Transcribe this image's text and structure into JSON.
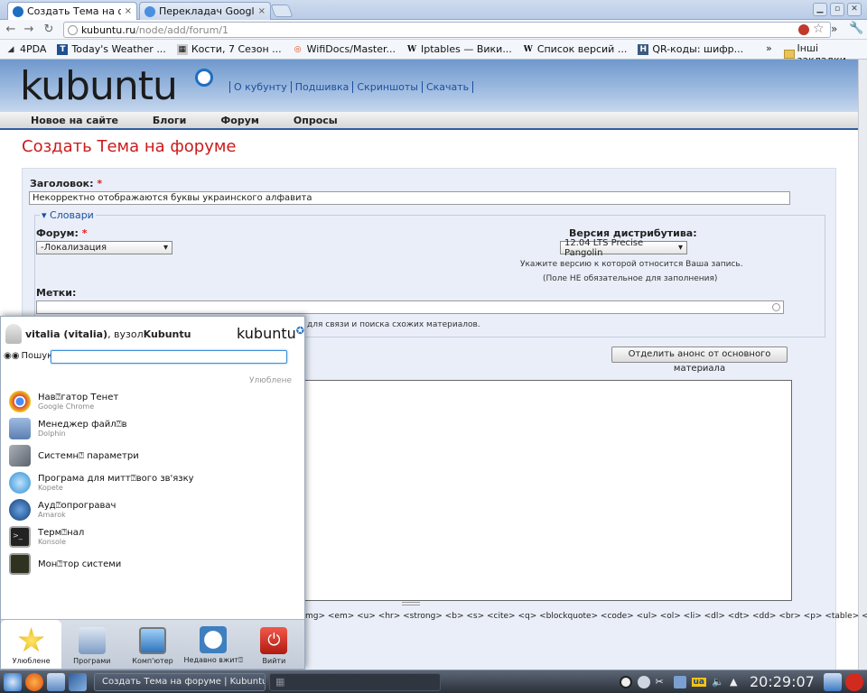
{
  "browser": {
    "tabs": [
      {
        "label": "Создать Тема на фору",
        "icon": "kubuntu-icon",
        "active": true
      },
      {
        "label": "Перекладач Google",
        "icon": "google-translate-icon",
        "active": false
      }
    ],
    "close_glyph": "×",
    "url_host": "kubuntu.ru",
    "url_path": "/node/add/forum/1",
    "bookmarks": [
      {
        "label": "4PDA",
        "icon": "4pda-icon"
      },
      {
        "label": "Today's Weather ...",
        "icon": "twc-icon"
      },
      {
        "label": "Кости, 7 Сезон ...",
        "icon": "video-icon"
      },
      {
        "label": "WifiDocs/Master...",
        "icon": "ubuntu-icon"
      },
      {
        "label": "Iptables — Вики...",
        "icon": "wikipedia-icon"
      },
      {
        "label": "Список версий ...",
        "icon": "wikipedia-icon"
      },
      {
        "label": "QR-коды: шифр...",
        "icon": "habr-icon"
      }
    ],
    "bookmarks_more": "»",
    "other_bookmarks": "Інші закладки"
  },
  "site": {
    "logo": "kubuntu",
    "top_links": [
      "О кубунту",
      "Подшивка",
      "Скриншоты",
      "Скачать"
    ],
    "nav": [
      "Новое на сайте",
      "Блоги",
      "Форум",
      "Опросы"
    ]
  },
  "form": {
    "page_title": "Создать Тема на форуме",
    "title_label": "Заголовок:",
    "required_mark": "*",
    "title_value": "Некорректно отображаются буквы украинского алфавита",
    "vocab_legend": "Словари",
    "forum_label": "Форум:",
    "forum_value": "-Локализация",
    "distro_label": "Версия дистрибутива:",
    "distro_value": "12.04 LTS Precise Pangolin",
    "distro_hint1": "Укажите версию к которой относится Ваша запись.",
    "distro_hint2": "(Поле НЕ обязательное для заполнения)",
    "tags_label": "Метки:",
    "tags_hint": "для связи и поиска схожих материалов.",
    "split_button": "Отделить анонс от основного материала",
    "allowed_tags": "mg> <em> <u> <hr> <strong> <b> <s> <cite> <q> <blockquote> <code> <ul> <ol> <li> <dl> <dt> <dd> <br> <p> <table> <tr> <td>"
  },
  "kde_menu": {
    "user": "vitalia (vitalia)",
    "host_prefix": ", вузол ",
    "host": "Kubuntu",
    "logo": "kubuntu",
    "search_label": "Пошук:",
    "favorites_label": "Улюблене",
    "items": [
      {
        "name": "Нав⍰гатор Тенет",
        "sub": "Google Chrome",
        "icon": "chrome-icon",
        "color": "#d94b3a"
      },
      {
        "name": "Менеджер файл⍰в",
        "sub": "Dolphin",
        "icon": "dolphin-icon",
        "color": "#6b8fb8"
      },
      {
        "name": "Системн⍰ параметри",
        "sub": "",
        "icon": "tools-icon",
        "color": "#8a8f98"
      },
      {
        "name": "Програма для митт⍰вого зв'язку",
        "sub": "Kopete",
        "icon": "kopete-icon",
        "color": "#4aa6e0"
      },
      {
        "name": "Ауд⍰опрогравач",
        "sub": "Amarok",
        "icon": "amarok-icon",
        "color": "#1f5fa8"
      },
      {
        "name": "Терм⍰нал",
        "sub": "Konsole",
        "icon": "terminal-icon",
        "color": "#2b2b2b"
      },
      {
        "name": "Мон⍰тор системи",
        "sub": "",
        "icon": "monitor-icon",
        "color": "#3a3f2a"
      }
    ],
    "tabs": [
      {
        "label": "Улюблене",
        "icon": "star-icon",
        "color": "#f2c516"
      },
      {
        "label": "Програми",
        "icon": "apps-icon",
        "color": "#7d9cc4"
      },
      {
        "label": "Комп'ютер",
        "icon": "computer-icon",
        "color": "#4b87c8"
      },
      {
        "label": "Недавно вжит⍰",
        "icon": "clock-icon",
        "color": "#3e7fc0"
      },
      {
        "label": "Вийти",
        "icon": "power-icon",
        "color": "#d22a1e"
      }
    ]
  },
  "taskbar": {
    "task_label": "Создать Тема на форуме | Kubuntu",
    "clock": "20:29:07",
    "keyboard_layout": "ua"
  },
  "colors": {
    "accent_red": "#cc1b1b",
    "link_blue": "#1b4fa0",
    "header_blue": "#6f98cd"
  }
}
